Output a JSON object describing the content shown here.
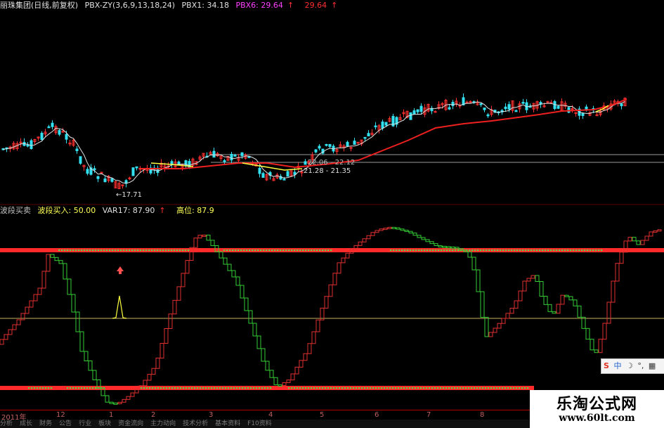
{
  "main_header": {
    "stock": "丽珠集团(日线,前复权)",
    "indicator": "PBX-ZY(3,6,9,13,18,24)",
    "pbx1_label": "PBX1: 34.18",
    "pbx6_label": "PBX6: 29.64",
    "pbx6_arrow": "↑",
    "extra_value": "29.64",
    "extra_arrow": "↑"
  },
  "chart_annotations": {
    "low_label": "←17.71",
    "range_label_1": "21.28 - 21.35",
    "range_label_2": "22.06 - 22.12"
  },
  "indicator_header": {
    "name": "波段买卖",
    "buy_label": "波段买入: 50.00",
    "var17_label": "VAR17: 87.90",
    "var17_arrow": "↑",
    "high_label": "高位: 87.9"
  },
  "date_axis": {
    "labels": [
      "2011年",
      "12",
      "1",
      "2",
      "3",
      "4",
      "5",
      "6",
      "7",
      "8"
    ]
  },
  "bottom_tabs": [
    "分析",
    "成长",
    "财务",
    "公告",
    "行业",
    "板块",
    "资金流向",
    "主力动向",
    "技术分析",
    "基本资料",
    "F10资料"
  ],
  "ime": {
    "logo": "S",
    "mode": "中",
    "moon": "☽",
    "comma": "°,",
    "grid": "▦"
  },
  "watermark": {
    "title": "乐淘公式网",
    "url": "www.60lt.com"
  },
  "colors": {
    "up": "#ff3030",
    "down": "#33e0f0",
    "ma_white": "#e0e0e0",
    "ma_red": "#ee2020",
    "yellow": "#ffff40",
    "ind_red": "#e03030",
    "ind_green": "#33cc33",
    "hline": "#ff2a2a"
  },
  "icons": [
    "up-arrow-icon"
  ]
}
